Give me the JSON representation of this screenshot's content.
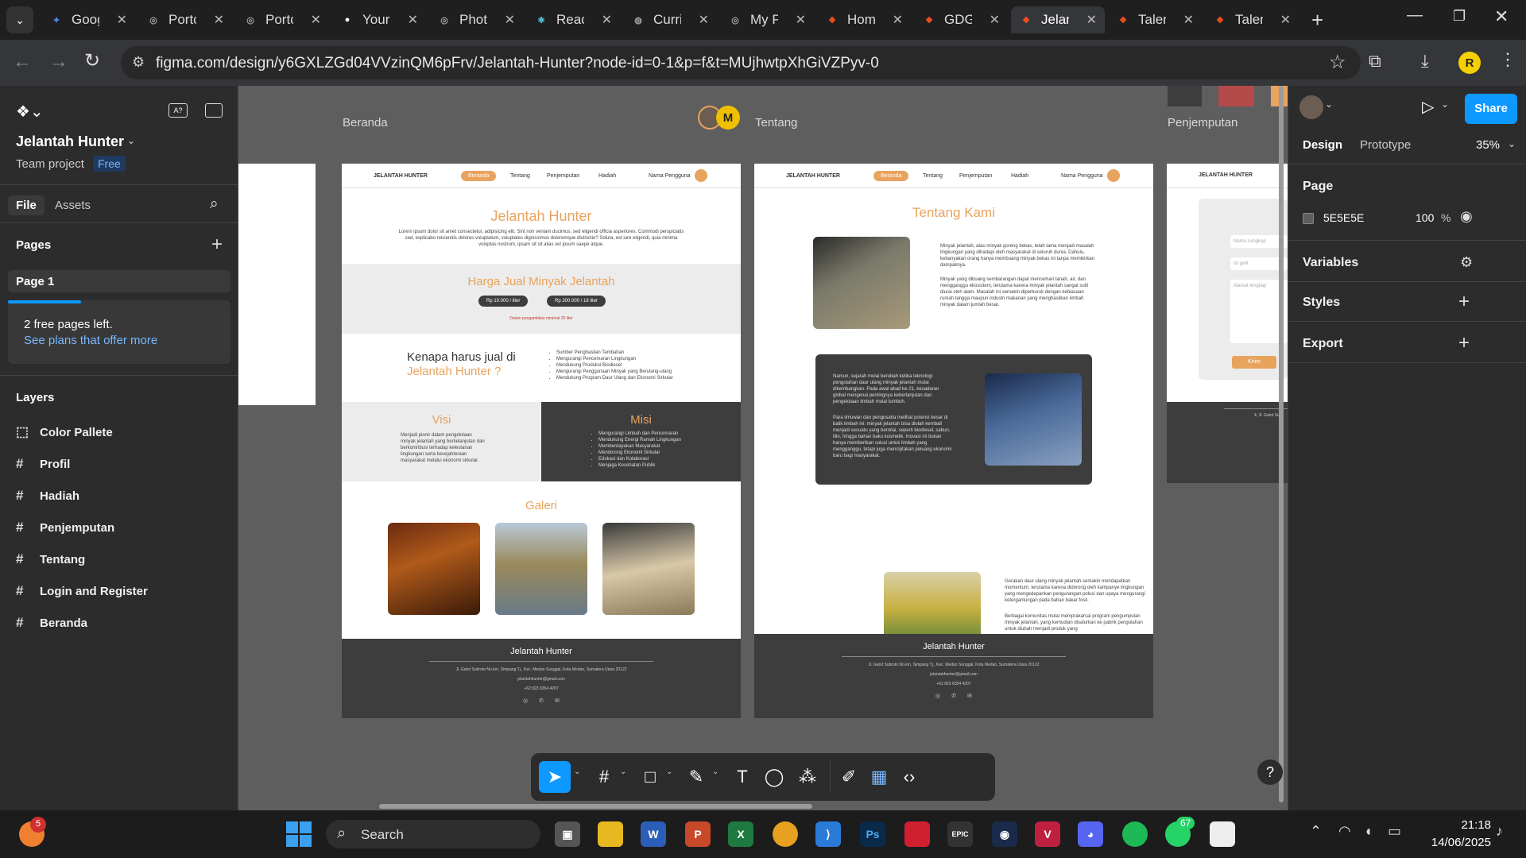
{
  "browser": {
    "tabs": [
      {
        "title": "Goog",
        "icon": "gemini-icon",
        "color": "#4c8df6",
        "glyph": "✦"
      },
      {
        "title": "Portc",
        "icon": "globe-icon",
        "color": "#9aa0a6",
        "glyph": "◎"
      },
      {
        "title": "Portc",
        "icon": "globe-icon",
        "color": "#9aa0a6",
        "glyph": "◎"
      },
      {
        "title": "Your",
        "icon": "github-icon",
        "color": "#ffffff",
        "glyph": "●"
      },
      {
        "title": "Phot",
        "icon": "globe-icon",
        "color": "#9aa0a6",
        "glyph": "◎"
      },
      {
        "title": "React",
        "icon": "react-icon",
        "color": "#61dafb",
        "glyph": "⚛"
      },
      {
        "title": "Curri",
        "icon": "web-icon",
        "color": "#9aa0a6",
        "glyph": "◍"
      },
      {
        "title": "My P",
        "icon": "globe-icon",
        "color": "#9aa0a6",
        "glyph": "◎"
      },
      {
        "title": "Hom",
        "icon": "figma-icon",
        "color": "#f24e1e",
        "glyph": "❖"
      },
      {
        "title": "GDG",
        "icon": "figma-icon",
        "color": "#f24e1e",
        "glyph": "❖"
      },
      {
        "title": "Jelan",
        "icon": "figma-icon",
        "color": "#f24e1e",
        "glyph": "❖"
      },
      {
        "title": "Talen",
        "icon": "figma-icon",
        "color": "#f24e1e",
        "glyph": "❖"
      },
      {
        "title": "Talen",
        "icon": "figma-icon",
        "color": "#f24e1e",
        "glyph": "❖"
      }
    ],
    "active_tab_index": 10,
    "url": "figma.com/design/y6GXLZGd04VVzinQM6pFrv/Jelantah-Hunter?node-id=0-1&p=f&t=MUjhwtpXhGiVZPyv-0",
    "profile_initial": "R"
  },
  "figma": {
    "project_title": "Jelantah Hunter",
    "team_label": "Team project",
    "plan_badge": "Free",
    "tabs": {
      "file": "File",
      "assets": "Assets"
    },
    "pages_heading": "Pages",
    "current_page": "Page 1",
    "upsell_title": "2 free pages left.",
    "upsell_link": "See plans that offer more",
    "layers_heading": "Layers",
    "layers": [
      {
        "name": "Color Pallete",
        "icon": "dashed-frame-icon",
        "glyph": "⬚"
      },
      {
        "name": "Profil",
        "icon": "frame-icon",
        "glyph": "#"
      },
      {
        "name": "Hadiah",
        "icon": "frame-icon",
        "glyph": "#"
      },
      {
        "name": "Penjemputan",
        "icon": "frame-icon",
        "glyph": "#"
      },
      {
        "name": "Tentang",
        "icon": "frame-icon",
        "glyph": "#"
      },
      {
        "name": "Login and Register",
        "icon": "frame-icon",
        "glyph": "#"
      },
      {
        "name": "Beranda",
        "icon": "frame-icon",
        "glyph": "#"
      }
    ],
    "right": {
      "tab_design": "Design",
      "tab_prototype": "Prototype",
      "zoom": "35%",
      "share": "Share",
      "page_heading": "Page",
      "bg_color": "5E5E5E",
      "bg_opacity": "100",
      "percent_sign": "%",
      "variables": "Variables",
      "styles": "Styles",
      "export": "Export"
    },
    "cursor_initial": "M"
  },
  "canvas": {
    "frames": {
      "beranda": "Beranda",
      "tentang": "Tentang",
      "penjemputan": "Penjemputan"
    },
    "site": {
      "brand": "JELANTAH HUNTER",
      "nav": [
        "Beranda",
        "Tentang",
        "Penjemputan",
        "Hadiah"
      ],
      "user": "Nama Pengguna",
      "hero_title": "Jelantah Hunter",
      "hero_text": "Lorem ipsum dolor sit amet consectetur, adipisicing elit. Sint non veniam ducimus, sed eligendi officia asperiores. Commodi perspiciatis sed, explicabo reiciendis dolores voluptatum, voluptates dignissimos doloremque distinctio? Soluta, est iure eligendi, quia minima voluptas nostrum, ipsam sit sit alias vel ipsum saepe atque.",
      "price_title": "Harga Jual Minyak Jelantah",
      "price_1": "Rp 10.000 / liter",
      "price_2": "Rp 200.000 / 18 liter",
      "price_note": "Dalam pengambilan minimal 20 liter",
      "why_title_1": "Kenapa harus jual di",
      "why_title_2": "Jelantah Hunter ?",
      "why_points": [
        "Sumber Penghasilan Tambahan",
        "Mengurangi Pencemaran Lingkungan",
        "Mendukung Produksi Biodiesel",
        "Mengurangi Penggunaan Minyak yang Berulang-ulang",
        "Mendukung Program Daur Ulang dan Ekonomi Sirkular"
      ],
      "visi_title": "Visi",
      "visi_text": "Menjadi pionir dalam pengelolaan minyak jelantah yang berkelanjutan dan berkontribusi terhadap kelestarian lingkungan serta kesejahteraan masyarakat melalui ekonomi sirkular.",
      "misi_title": "Misi",
      "misi_points": [
        "Mengurangi Limbah dan Pencemaran",
        "Mendukung Energi Ramah Lingkungan",
        "Memberdayakan Masyarakat",
        "Mendorong Ekonomi Sirkular",
        "Edukasi dan Kolaborasi",
        "Menjaga Kesehatan Publik"
      ],
      "gallery_title": "Galeri",
      "footer_title": "Jelantah Hunter",
      "footer_addr": "Jl. Gatot Subroto No.km, Simpang Tj., Kec. Medan Sunggal, Kota Medan, Sumatera Utara 20122",
      "footer_email": "jelantahhunter@gmail.com",
      "footer_phone": "+62 823 6354 4207",
      "about_title": "Tentang Kami",
      "about_p1": "Minyak jelantah, atau minyak goreng bekas, telah lama menjadi masalah lingkungan yang dihadapi oleh masyarakat di seluruh dunia. Dahulu, kebanyakan orang hanya membuang minyak bekas ini tanpa memikirkan dampaknya.",
      "about_p2": "Minyak yang dibuang sembarangan dapat mencemari tanah, air, dan mengganggu ekosistem, terutama karena minyak jelantah sangat sulit diurai oleh alam. Masalah ini semakin diperburuk dengan kebiasaan rumah tangga maupun industri makanan yang menghasilkan limbah minyak dalam jumlah besar.",
      "about_p3": "Namun, sejarah mulai berubah ketika teknologi pengolahan daur ulang minyak jelantah mulai dikembangkan. Pada awal abad ke-21, kesadaran global mengenai pentingnya keberlanjutan dan pengelolaan limbah mulai tumbuh.",
      "about_p4": "Para ilmuwan dan pengusaha melihat potensi besar di balik limbah ini: minyak jelantah bisa diolah kembali menjadi sesuatu yang bernilai, seperti biodiesel, sabun, lilin, hingga bahan baku kosmetik. Inovasi ini bukan hanya memberikan solusi untuk limbah yang mengganggu, tetapi juga menciptakan peluang ekonomi baru bagi masyarakat.",
      "about_p5": "Gerakan daur ulang minyak jelantah semakin mendapatkan momentum, terutama karena didorong oleh kampanye lingkungan yang mengedepankan pengurangan polusi dan upaya mengurangi ketergantungan pada bahan bakar fosil.",
      "about_p6": "Berbagai komunitas mulai memprakarsai program pengumpulan minyak jelantah, yang kemudian disalurkan ke pabrik pengolahan untuk diubah menjadi produk yang",
      "form_name": "Nama Lengkap",
      "form_qty": "Isi gelli",
      "form_addr": "Alamat lengkap",
      "form_submit": "Kirim",
      "footer_short": "4, Jl. Gatot Su"
    }
  },
  "toolbar": {
    "tools": [
      "move-icon",
      "frame-icon",
      "rectangle-icon",
      "pen-icon",
      "text-icon",
      "comment-icon",
      "actions-icon",
      "draw-icon",
      "layout-icon",
      "dev-mode-icon"
    ]
  },
  "taskbar": {
    "search": "Search",
    "time": "21:18",
    "date": "14/06/2025",
    "whatsapp_badge": "67",
    "start_badge": "5"
  }
}
